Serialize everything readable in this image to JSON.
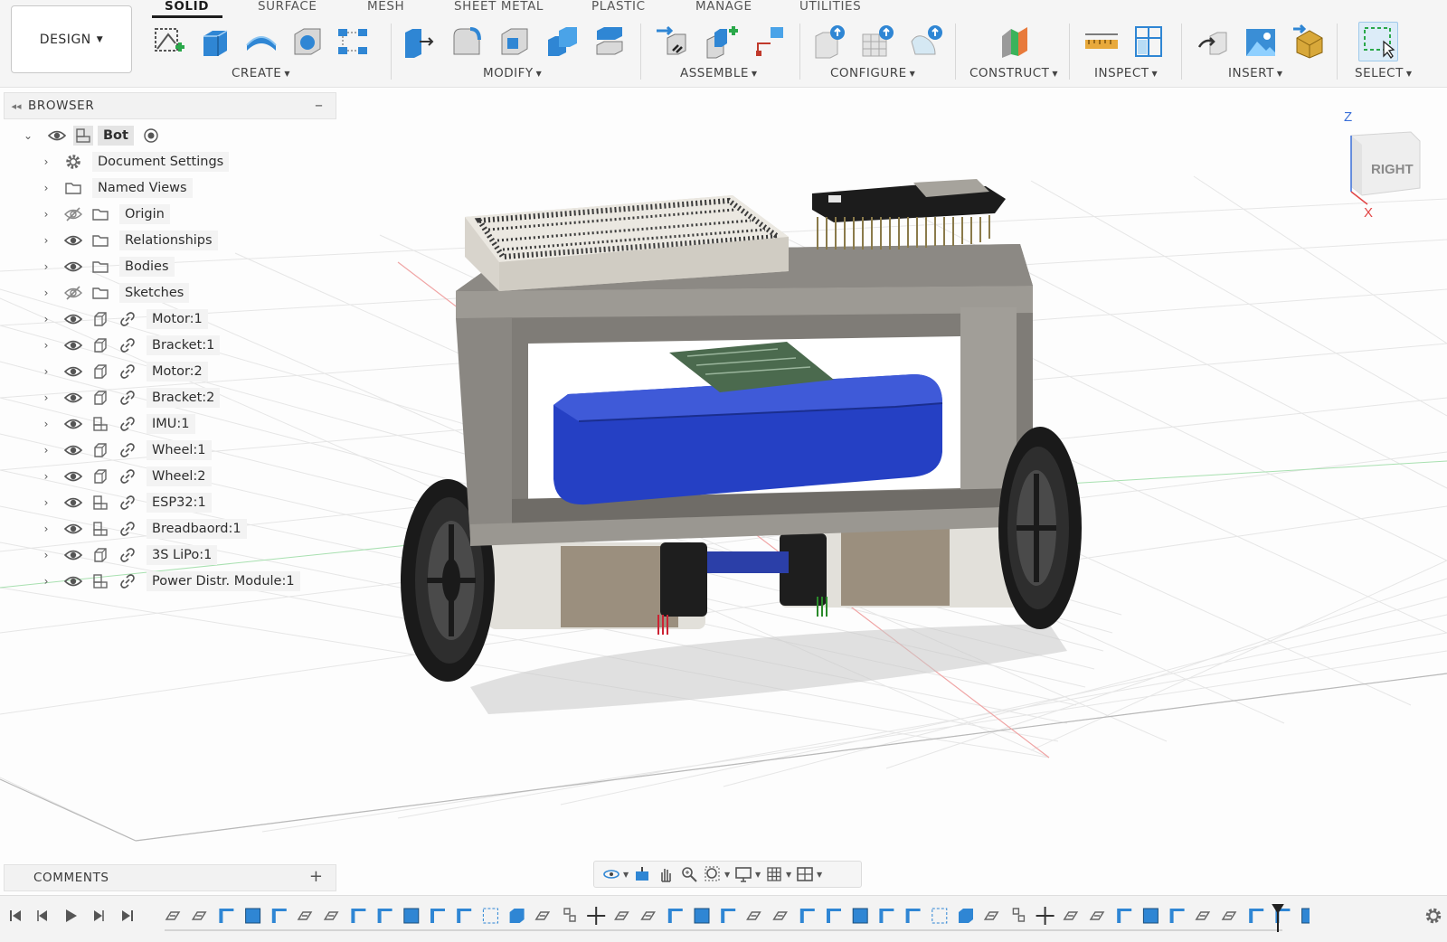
{
  "workspace": {
    "label": "DESIGN"
  },
  "tabs": [
    {
      "label": "SOLID",
      "active": true
    },
    {
      "label": "SURFACE",
      "active": false
    },
    {
      "label": "MESH",
      "active": false
    },
    {
      "label": "SHEET METAL",
      "active": false
    },
    {
      "label": "PLASTIC",
      "active": false
    },
    {
      "label": "MANAGE",
      "active": false
    },
    {
      "label": "UTILITIES",
      "active": false
    }
  ],
  "tool_groups": [
    {
      "label": "CREATE",
      "tools": [
        "create-sketch-icon",
        "extrude-icon",
        "revolve-icon",
        "hole-icon",
        "pattern-icon"
      ]
    },
    {
      "label": "MODIFY",
      "tools": [
        "press-pull-icon",
        "fillet-icon",
        "shell-icon",
        "combine-icon",
        "align-icon"
      ]
    },
    {
      "label": "ASSEMBLE",
      "tools": [
        "joint-icon",
        "new-component-icon",
        "rigid-group-icon"
      ]
    },
    {
      "label": "CONFIGURE",
      "tools": [
        "configure-icon",
        "configure-table-icon",
        "configure-theme-icon"
      ]
    },
    {
      "label": "CONSTRUCT",
      "tools": [
        "offset-plane-icon"
      ]
    },
    {
      "label": "INSPECT",
      "tools": [
        "measure-icon",
        "interference-icon"
      ]
    },
    {
      "label": "INSERT",
      "tools": [
        "insert-derive-icon",
        "insert-canvas-icon",
        "insert-mesh-icon"
      ]
    },
    {
      "label": "SELECT",
      "tools": [
        "window-select-icon"
      ]
    }
  ],
  "browser": {
    "title": "BROWSER",
    "root": {
      "label": "Bot"
    },
    "items": [
      {
        "label": "Document Settings",
        "icon": "gear-icon",
        "visible": null,
        "linked": false
      },
      {
        "label": "Named Views",
        "icon": "folder-icon",
        "visible": null,
        "linked": false
      },
      {
        "label": "Origin",
        "icon": "folder-icon",
        "visible": false,
        "linked": false
      },
      {
        "label": "Relationships",
        "icon": "folder-icon",
        "visible": true,
        "linked": false
      },
      {
        "label": "Bodies",
        "icon": "folder-icon",
        "visible": true,
        "linked": false
      },
      {
        "label": "Sketches",
        "icon": "folder-icon",
        "visible": false,
        "linked": false
      },
      {
        "label": "Motor:1",
        "icon": "component-icon",
        "visible": true,
        "linked": true
      },
      {
        "label": "Bracket:1",
        "icon": "component-icon",
        "visible": true,
        "linked": true
      },
      {
        "label": "Motor:2",
        "icon": "component-icon",
        "visible": true,
        "linked": true
      },
      {
        "label": "Bracket:2",
        "icon": "component-icon",
        "visible": true,
        "linked": true
      },
      {
        "label": "IMU:1",
        "icon": "assembly-icon",
        "visible": true,
        "linked": true
      },
      {
        "label": "Wheel:1",
        "icon": "component-icon",
        "visible": true,
        "linked": true
      },
      {
        "label": "Wheel:2",
        "icon": "component-icon",
        "visible": true,
        "linked": true
      },
      {
        "label": "ESP32:1",
        "icon": "assembly-icon",
        "visible": true,
        "linked": true
      },
      {
        "label": "Breadbaord:1",
        "icon": "assembly-icon",
        "visible": true,
        "linked": true
      },
      {
        "label": "3S LiPo:1",
        "icon": "component-icon",
        "visible": true,
        "linked": true
      },
      {
        "label": "Power Distr. Module:1",
        "icon": "assembly-icon",
        "visible": true,
        "linked": true
      }
    ]
  },
  "comments": {
    "title": "COMMENTS"
  },
  "viewcube": {
    "face": "RIGHT",
    "axis_z": "Z",
    "axis_x": "X"
  },
  "colors": {
    "accent": "#0696d7",
    "battery": "#2a45c4",
    "frame": "#8f8c86",
    "pcb": "#4f6f52",
    "esp32": "#1c1c1c"
  },
  "navbar": {
    "tools": [
      "orbit-icon",
      "look-at-icon",
      "pan-icon",
      "zoom-icon",
      "fit-icon",
      "display-settings-icon",
      "grid-icon",
      "viewports-icon"
    ]
  },
  "timeline": {
    "controls": [
      "go-to-start-icon",
      "step-back-icon",
      "play-icon",
      "step-forward-icon",
      "go-to-end-icon"
    ],
    "feature_count": 44
  }
}
